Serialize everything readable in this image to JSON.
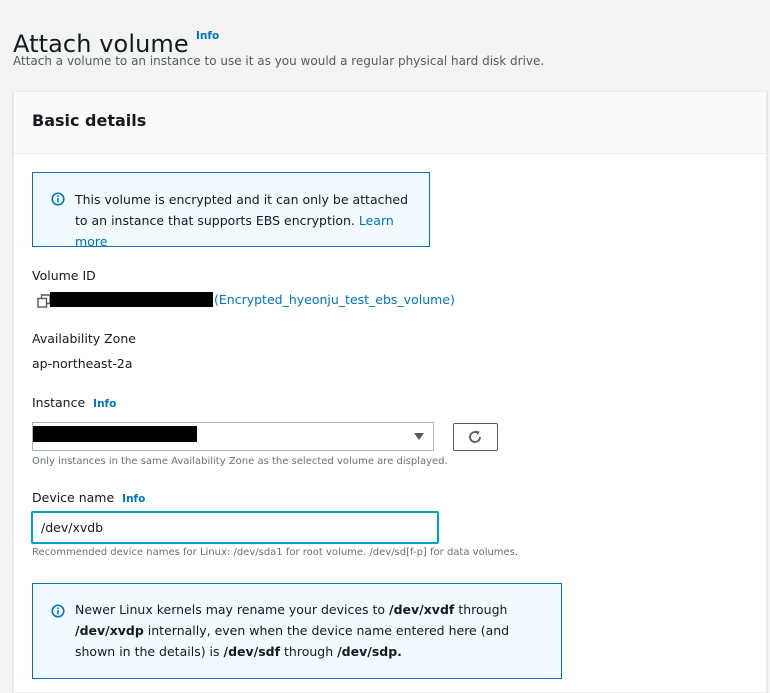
{
  "page": {
    "title": "Attach volume",
    "info_label": "Info",
    "description": "Attach a volume to an instance to use it as you would a regular physical hard disk drive."
  },
  "panel": {
    "title": "Basic details",
    "encryption_alert": {
      "text": "This volume is encrypted and it can only be attached to an instance that supports EBS encryption.",
      "link": "Learn more"
    },
    "volume_id": {
      "label": "Volume ID",
      "name": "(Encrypted_hyeonju_test_ebs_volume)"
    },
    "availability_zone": {
      "label": "Availability Zone",
      "value": "ap-northeast-2a"
    },
    "instance": {
      "label": "Instance",
      "info_label": "Info",
      "hint": "Only instances in the same Availability Zone as the selected volume are displayed."
    },
    "device_name": {
      "label": "Device name",
      "info_label": "Info",
      "value": "/dev/xvdb",
      "hint": "Recommended device names for Linux: /dev/sda1 for root volume. /dev/sd[f-p] for data volumes."
    },
    "kernel_alert": {
      "t1": "Newer Linux kernels may rename your devices to ",
      "b1": "/dev/xvdf",
      "t2": " through ",
      "b2": "/dev/xvdp",
      "t3": " internally, even when the device name entered here (and shown in the details) is ",
      "b3": "/dev/sdf",
      "t4": " through ",
      "b4": "/dev/sdp."
    }
  },
  "colors": {
    "link": "#0073bb",
    "alert_border": "#0073bb",
    "alert_background": "#f1faff",
    "focus_border": "#00a1c9",
    "page_background": "#f2f3f3"
  },
  "icons": {
    "alert": "info-circle-icon",
    "copy": "copy-icon",
    "dropdown": "caret-down-icon",
    "refresh": "refresh-icon"
  }
}
